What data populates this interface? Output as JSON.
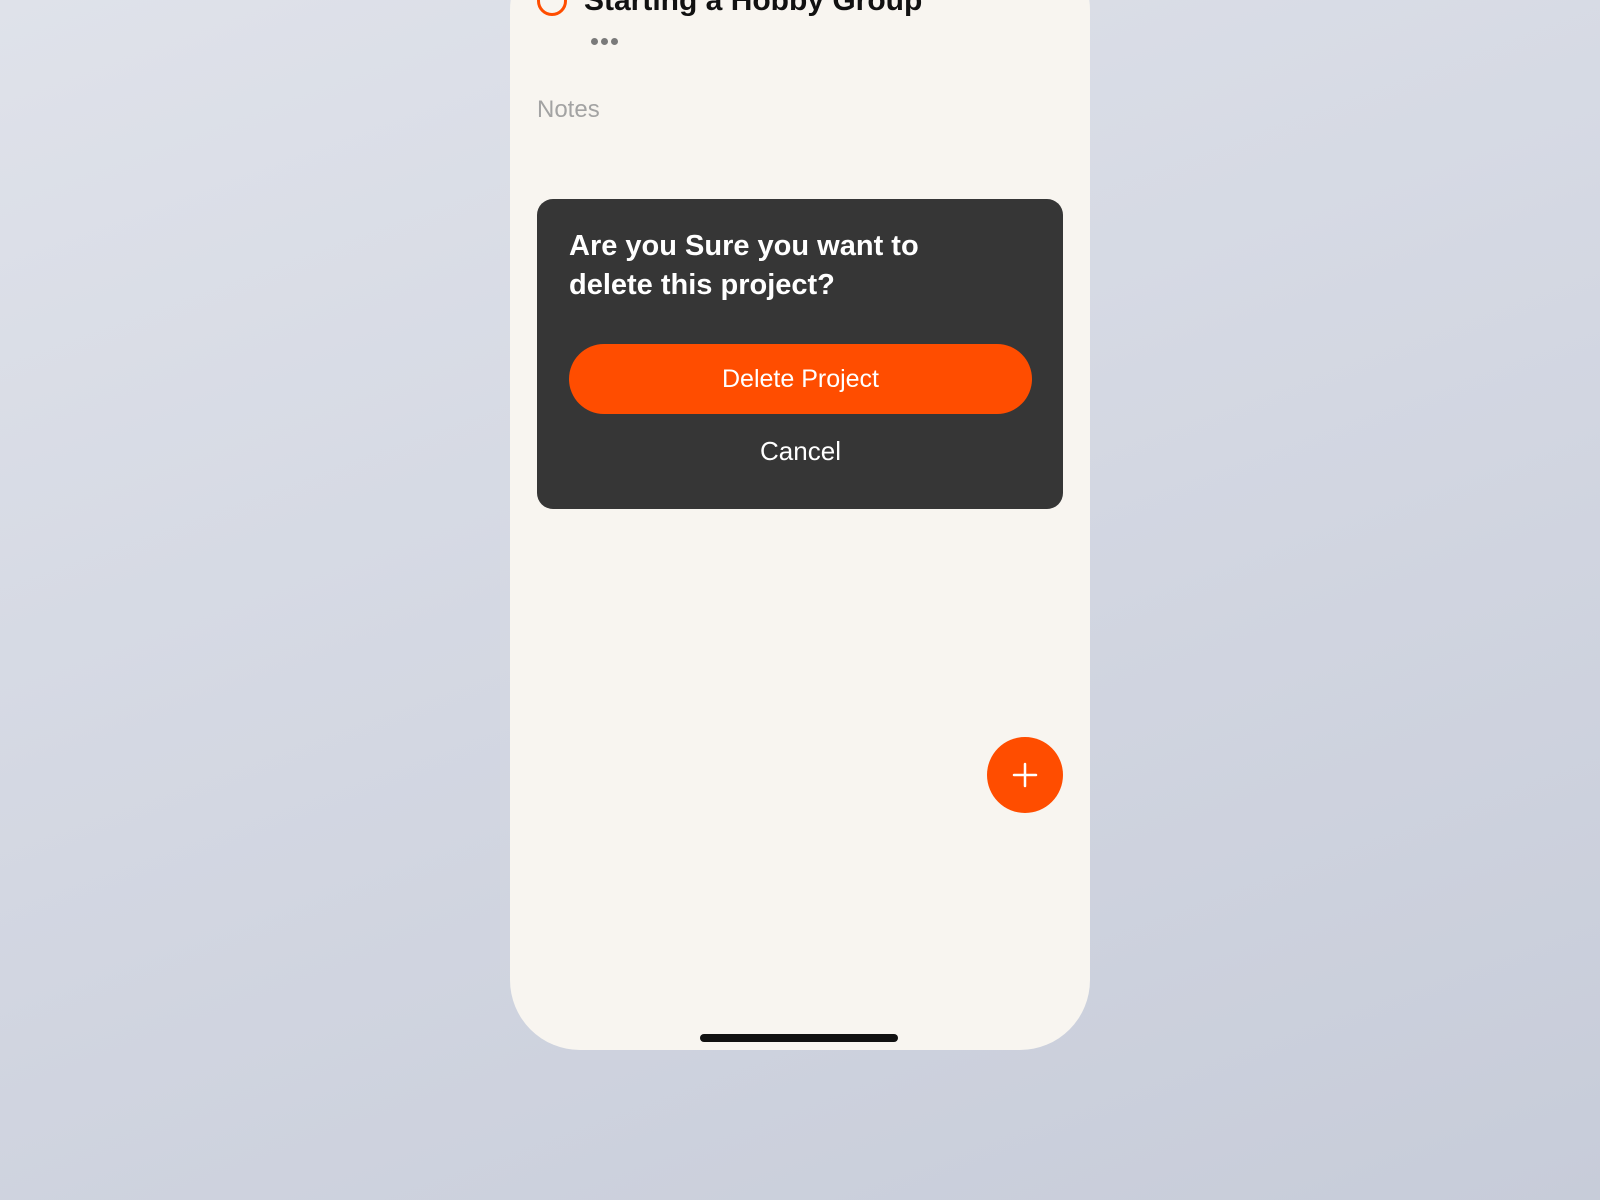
{
  "project": {
    "title": "Starting a Hobby Group",
    "status_icon": "circle-check-icon",
    "more_icon": "more-dots-icon"
  },
  "notes": {
    "label": "Notes"
  },
  "dialog": {
    "message": "Are you Sure you want  to\ndelete this project?",
    "delete_label": "Delete Project",
    "cancel_label": "Cancel"
  },
  "fab": {
    "icon": "plus-icon"
  },
  "colors": {
    "accent": "#ff4d00",
    "dialog_bg": "#363636",
    "screen_bg": "#f8f5f0",
    "muted_text": "#a3a3a3"
  }
}
